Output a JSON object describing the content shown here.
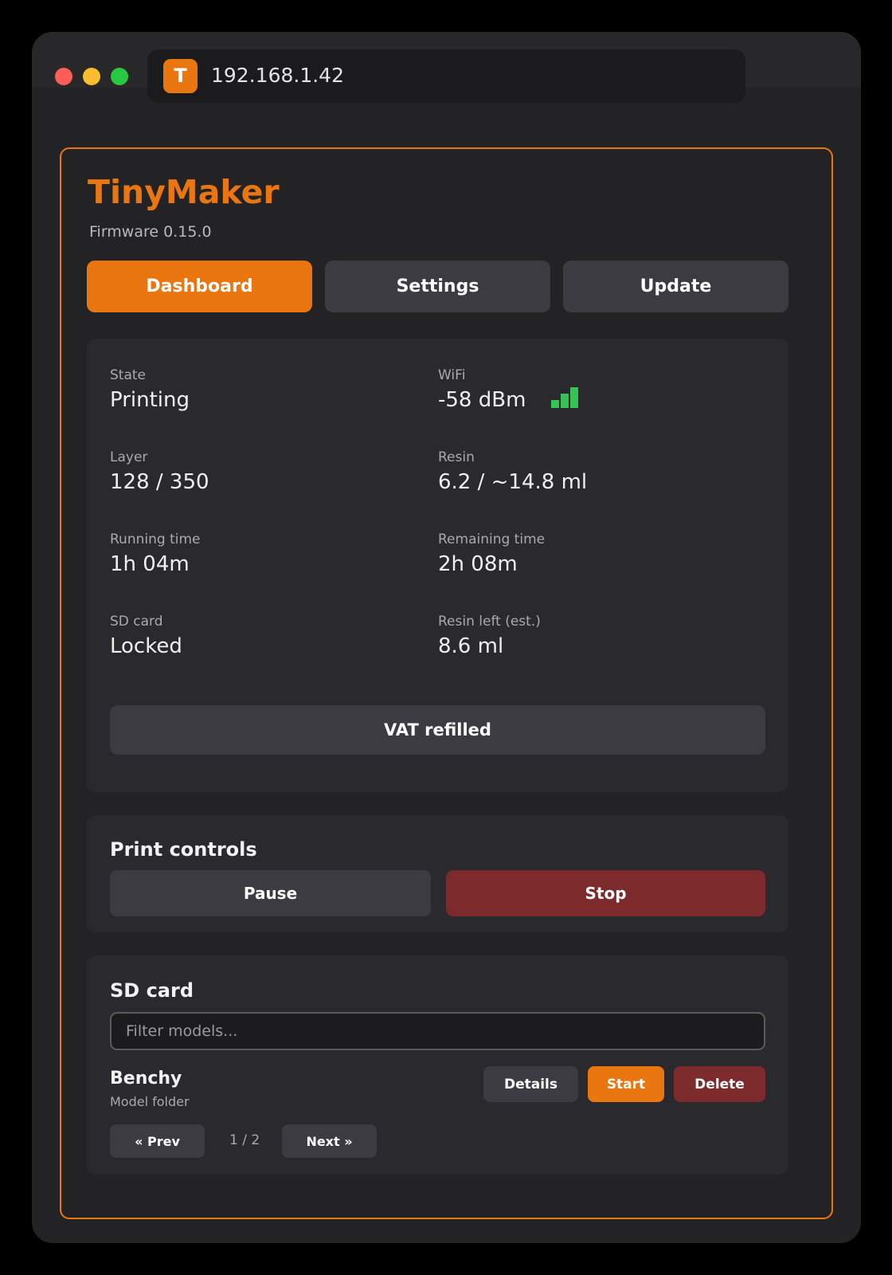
{
  "browser": {
    "url": "192.168.1.42",
    "site_badge": "T"
  },
  "app": {
    "title": "TinyMaker",
    "firmware": "Firmware 0.15.0"
  },
  "tabs": [
    {
      "label": "Dashboard",
      "active": true
    },
    {
      "label": "Settings",
      "active": false
    },
    {
      "label": "Update",
      "active": false
    }
  ],
  "status": {
    "state": {
      "label": "State",
      "value": "Printing"
    },
    "wifi": {
      "label": "WiFi",
      "value": "-58 dBm",
      "signal_bars": 3,
      "signal_color": "#38c455"
    },
    "layer": {
      "label": "Layer",
      "value": "128 / 350"
    },
    "resin": {
      "label": "Resin",
      "value": "6.2 / ~14.8 ml"
    },
    "running_time": {
      "label": "Running time",
      "value": "1h 04m"
    },
    "remaining_time": {
      "label": "Remaining time",
      "value": "2h 08m"
    },
    "sd_card": {
      "label": "SD card",
      "value": "Locked"
    },
    "resin_left": {
      "label": "Resin left (est.)",
      "value": "8.6 ml"
    },
    "vat_button": "VAT refilled"
  },
  "controls": {
    "title": "Print controls",
    "pause": "Pause",
    "stop": "Stop"
  },
  "sd": {
    "title": "SD card",
    "filter_placeholder": "Filter models...",
    "filter_value": "",
    "model": {
      "name": "Benchy",
      "type": "Model folder"
    },
    "details": "Details",
    "start": "Start",
    "delete": "Delete",
    "prev": "« Prev",
    "next": "Next »",
    "page": "1 / 2"
  },
  "colors": {
    "accent": "#ea760f",
    "danger": "#7c2a2c",
    "background": "#232326",
    "card": "#2a2a2e"
  }
}
